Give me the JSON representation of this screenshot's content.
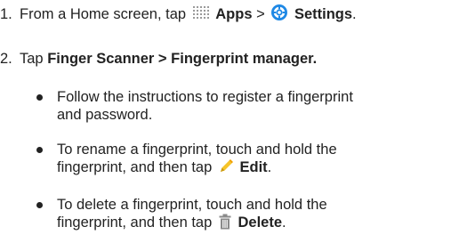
{
  "steps": [
    {
      "number": "1.",
      "text_before": "From a Home screen, tap",
      "apps_icon": "apps-grid-icon",
      "apps_label": "Apps",
      "separator": ">",
      "settings_icon": "settings-gear-icon",
      "settings_label": "Settings",
      "end": "."
    },
    {
      "number": "2.",
      "text_before": "Tap",
      "finger_scanner_label": "Finger Scanner",
      "separator": ">",
      "fingerprint_manager_label": "Fingerprint manager."
    }
  ],
  "bullets": [
    {
      "line1": "Follow the instructions to register a fingerprint",
      "line2": "and password."
    },
    {
      "line1": "To rename a fingerprint, touch and hold the",
      "line2_before": "fingerprint, and then tap",
      "icon": "pencil-edit-icon",
      "action_label": "Edit",
      "end": "."
    },
    {
      "line1": "To delete a fingerprint, touch and hold the",
      "line2_before": "fingerprint, and then tap",
      "icon": "trash-delete-icon",
      "action_label": "Delete",
      "end": "."
    }
  ]
}
